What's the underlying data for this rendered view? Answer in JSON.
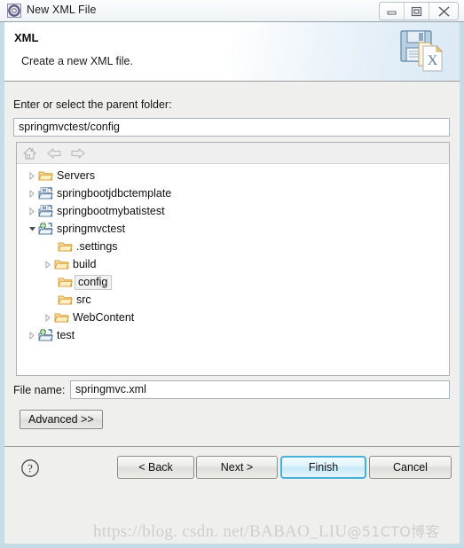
{
  "window": {
    "title": "New XML File",
    "icon": "xml-wizard-icon",
    "controls": [
      {
        "name": "minimize-button",
        "glyph": "minimize-icon"
      },
      {
        "name": "maximize-button",
        "glyph": "restore-icon"
      },
      {
        "name": "close-button",
        "glyph": "close-icon"
      }
    ]
  },
  "header": {
    "title": "XML",
    "subtitle": "Create a new XML file.",
    "icon": "xml-file-save-icon"
  },
  "main": {
    "parent_folder_label": "Enter or select the parent folder:",
    "parent_folder_value": "springmvctest/config",
    "parent_folder_placeholder": "",
    "tree_toolbar": [
      {
        "name": "home-icon",
        "enabled": false
      },
      {
        "name": "back-arrow-icon",
        "enabled": false
      },
      {
        "name": "forward-arrow-icon",
        "enabled": false
      }
    ],
    "tree": [
      {
        "label": "Servers",
        "depth": 0,
        "icon": "folder",
        "twisty": "collapsed",
        "selected": false
      },
      {
        "label": "springbootjdbctemplate",
        "depth": 0,
        "icon": "project-maven",
        "twisty": "collapsed",
        "selected": false
      },
      {
        "label": "springbootmybatistest",
        "depth": 0,
        "icon": "project-maven",
        "twisty": "collapsed",
        "selected": false
      },
      {
        "label": "springmvctest",
        "depth": 0,
        "icon": "project-web",
        "twisty": "expanded",
        "selected": false
      },
      {
        "label": ".settings",
        "depth": 1,
        "icon": "folder",
        "twisty": "none",
        "selected": false
      },
      {
        "label": "build",
        "depth": 1,
        "icon": "folder",
        "twisty": "collapsed",
        "selected": false
      },
      {
        "label": "config",
        "depth": 1,
        "icon": "folder",
        "twisty": "none",
        "selected": true
      },
      {
        "label": "src",
        "depth": 1,
        "icon": "folder",
        "twisty": "none",
        "selected": false
      },
      {
        "label": "WebContent",
        "depth": 1,
        "icon": "folder",
        "twisty": "collapsed",
        "selected": false
      },
      {
        "label": "test",
        "depth": 0,
        "icon": "project-web",
        "twisty": "collapsed",
        "selected": false
      }
    ],
    "file_name_label": "File name:",
    "file_name_value": "springmvc.xml",
    "file_name_placeholder": "",
    "advanced_label": "Advanced >>"
  },
  "footer": {
    "help_icon": "help-question-icon",
    "back_label": "< Back",
    "next_label": "Next >",
    "finish_label": "Finish",
    "cancel_label": "Cancel"
  },
  "watermark": {
    "url_text": "https://blog. csdn. net/BABAO_LIU",
    "suffix_text": "@51CTO博客"
  },
  "colors": {
    "accent": "#4aaed6",
    "folder": "#f0b44a",
    "dialog_bg": "#eff0ee",
    "panel_bg": "#ffffff",
    "border": "#9c9c9c"
  }
}
